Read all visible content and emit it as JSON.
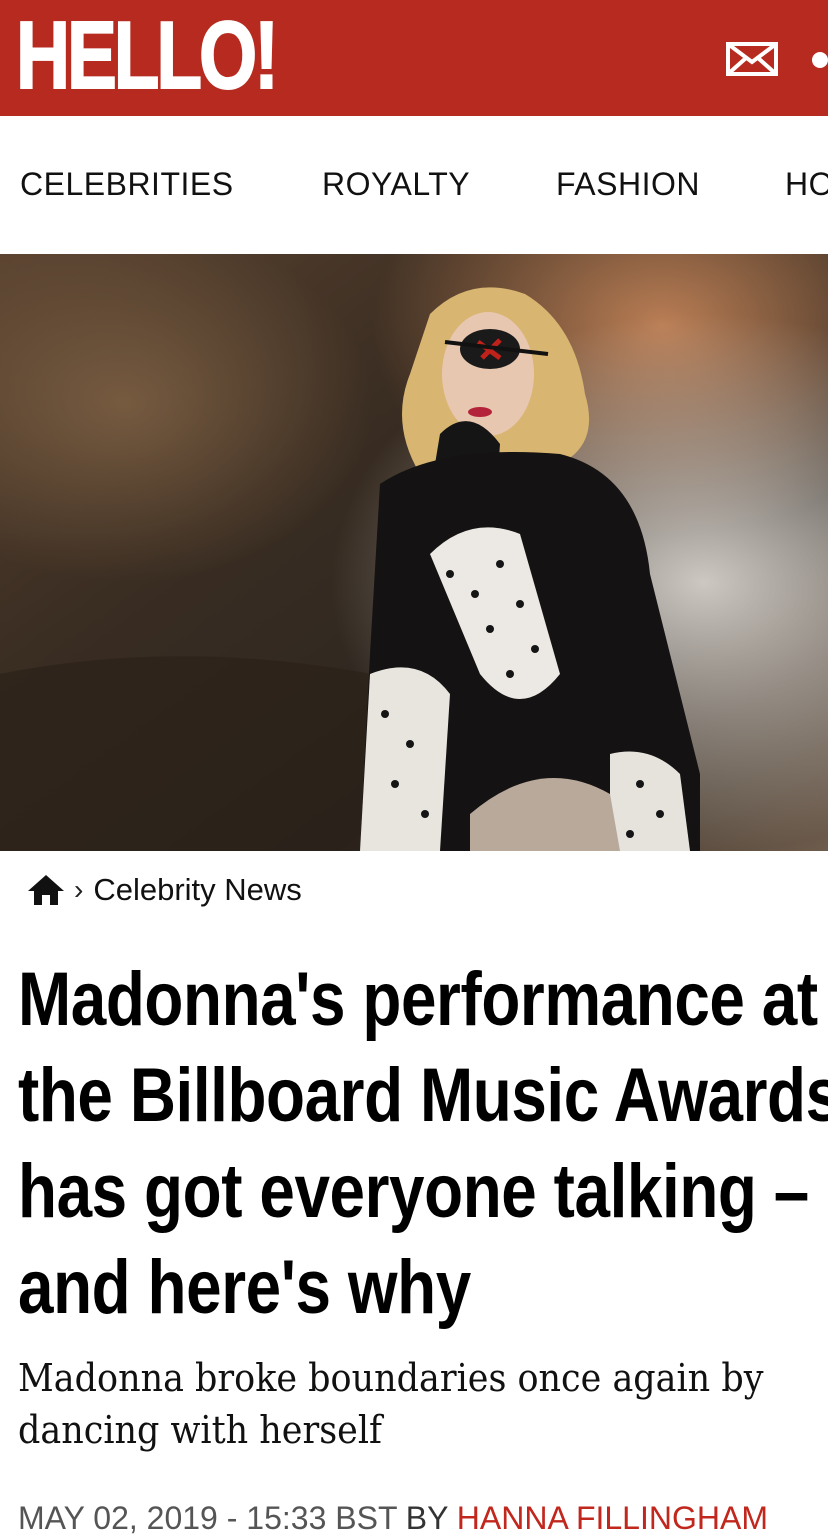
{
  "header": {
    "logo": "HELLO!",
    "brand_color": "#b72a1f",
    "mail_icon": "envelope-icon"
  },
  "nav": {
    "items": [
      "CELEBRITIES",
      "ROYALTY",
      "FASHION",
      "HO"
    ]
  },
  "hero": {
    "alt_icon": "photo-image"
  },
  "breadcrumb": {
    "home_icon": "home-icon",
    "separator": "›",
    "label": "Celebrity News"
  },
  "article": {
    "headline": "Madonna's performance at the Billboard Music Awards has got everyone talking – and here's why",
    "standfirst": "Madonna broke boundaries once again by dancing with herself",
    "date": "MAY 02, 2019 - 15:33 BST",
    "by": "BY",
    "author": "HANNA FILLINGHAM",
    "author_color": "#c1271c"
  }
}
